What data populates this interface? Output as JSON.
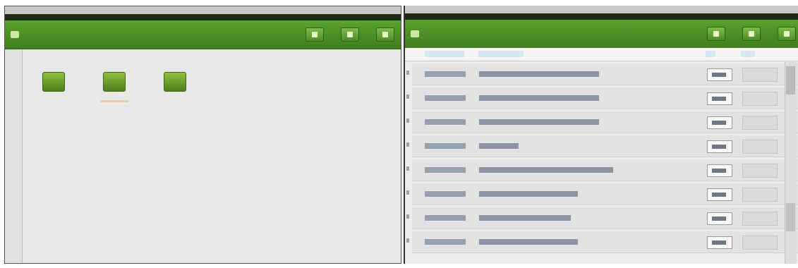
{
  "left_window": {
    "title": "",
    "desktop_icons": [
      {
        "icon": "folder-icon",
        "caption": ""
      },
      {
        "icon": "folder-icon",
        "caption": ""
      },
      {
        "icon": "folder-icon",
        "caption": ""
      }
    ],
    "toolbar_buttons": [
      "",
      "",
      ""
    ]
  },
  "right_window": {
    "title": "",
    "columns": [
      "",
      "",
      "",
      ""
    ],
    "rows": [
      {
        "date": "",
        "subject": ""
      },
      {
        "date": "",
        "subject": ""
      },
      {
        "date": "",
        "subject": ""
      },
      {
        "date": "",
        "subject": ""
      },
      {
        "date": "",
        "subject": ""
      },
      {
        "date": "",
        "subject": ""
      },
      {
        "date": "",
        "subject": ""
      },
      {
        "date": "",
        "subject": ""
      }
    ],
    "toolbar_buttons": [
      "",
      "",
      ""
    ]
  },
  "colors": {
    "accent_green": "#4f8f25",
    "background": "#e8e8e8"
  }
}
